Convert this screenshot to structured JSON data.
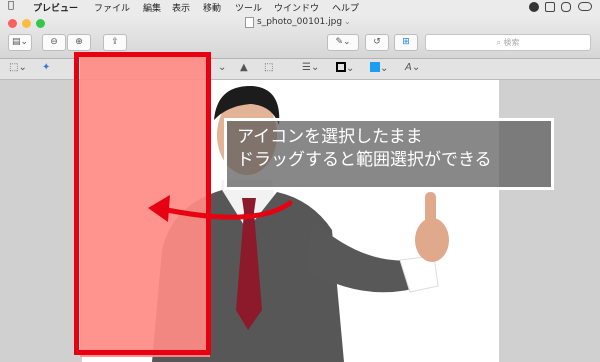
{
  "menubar": {
    "app_name": "プレビュー",
    "items": [
      "ファイル",
      "編集",
      "表示",
      "移動",
      "ツール",
      "ウインドウ",
      "ヘルプ"
    ]
  },
  "window": {
    "title": "s_photo_00101.jpg",
    "search_placeholder": "検索"
  },
  "callout": {
    "line1": "アイコンを選択したまま",
    "line2": "ドラッグすると範囲選択ができる"
  },
  "colors": {
    "selection_fill": "#ff8a84",
    "highlight_border": "#e60012",
    "close": "#fc605c",
    "minimize": "#fdbc40",
    "zoom": "#34c84a"
  }
}
